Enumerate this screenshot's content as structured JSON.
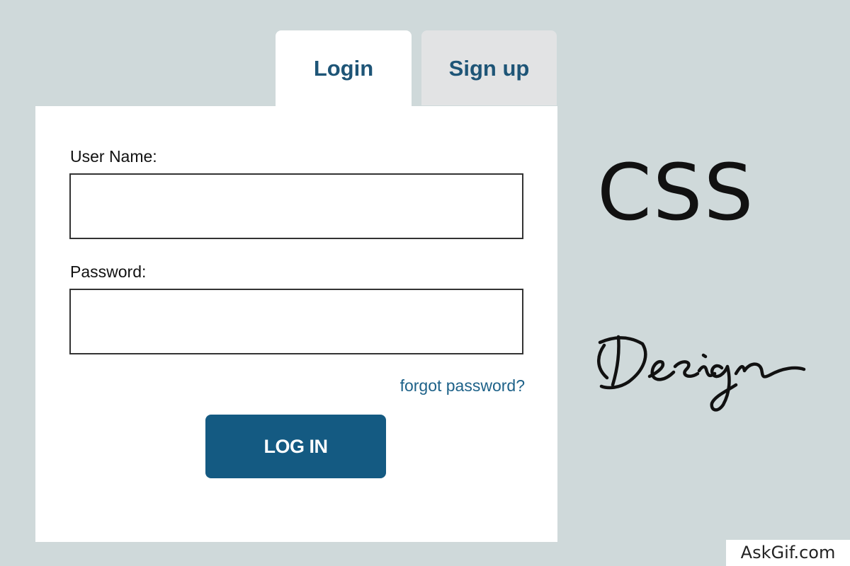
{
  "tabs": [
    {
      "label": "Login",
      "active": true
    },
    {
      "label": "Sign up",
      "active": false
    }
  ],
  "form": {
    "username_label": "User Name:",
    "username_value": "",
    "password_label": "Password:",
    "password_value": "",
    "forgot_link": "forgot password?",
    "submit_label": "LOG IN"
  },
  "side_text": {
    "title": "CSS",
    "signature": "Design"
  },
  "watermark": "AskGif.com",
  "colors": {
    "background": "#cfd9da",
    "accent": "#145a82",
    "link": "#1e6289",
    "inactive_tab": "#e2e3e4"
  }
}
